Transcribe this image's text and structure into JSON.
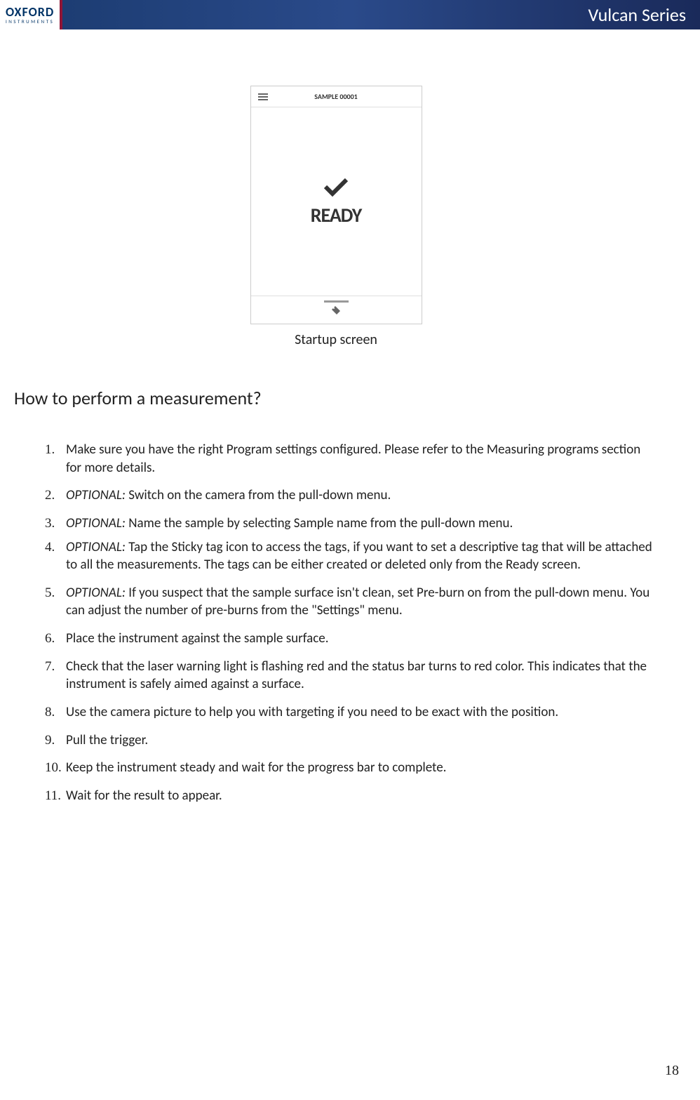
{
  "header": {
    "logo_main": "OXFORD",
    "logo_sub": "INSTRUMENTS",
    "title": "Vulcan Series"
  },
  "screenshot": {
    "sample_name": "SAMPLE 00001",
    "status": "READY"
  },
  "caption": "Startup screen",
  "section_title": "How to perform a measurement?",
  "steps": [
    {
      "text": "Make sure you have the right Program settings configured. Please refer to the Measuring programs section for more details.",
      "optional": false
    },
    {
      "text": "Switch on the camera from the pull-down menu.",
      "optional": true
    },
    {
      "text": "Name the sample by selecting Sample name from the pull-down menu.",
      "optional": true
    },
    {
      "text": "Tap the Sticky tag icon to access the tags, if you want to set a descriptive tag that will be attached to all the measurements. The tags can be either created or deleted only from the Ready screen.",
      "optional": true
    },
    {
      "text": "If you suspect that the sample surface isn't clean, set Pre-burn on from the pull-down menu. You can adjust the number of pre-burns from the \"Settings\" menu.",
      "optional": true
    },
    {
      "text": "Place the instrument against the sample surface.",
      "optional": false
    },
    {
      "text": "Check that the laser warning light is flashing red and the status bar turns to red color. This indicates that the instrument is safely aimed against a surface.",
      "optional": false
    },
    {
      "text": "Use the camera picture to help you with targeting if you need to be exact with the position.",
      "optional": false
    },
    {
      "text": "Pull the trigger.",
      "optional": false
    },
    {
      "text": "Keep the instrument steady and wait for the progress bar to complete.",
      "optional": false
    },
    {
      "text": "Wait for the result to appear.",
      "optional": false
    }
  ],
  "optional_label": "OPTIONAL: ",
  "page_number": "18"
}
